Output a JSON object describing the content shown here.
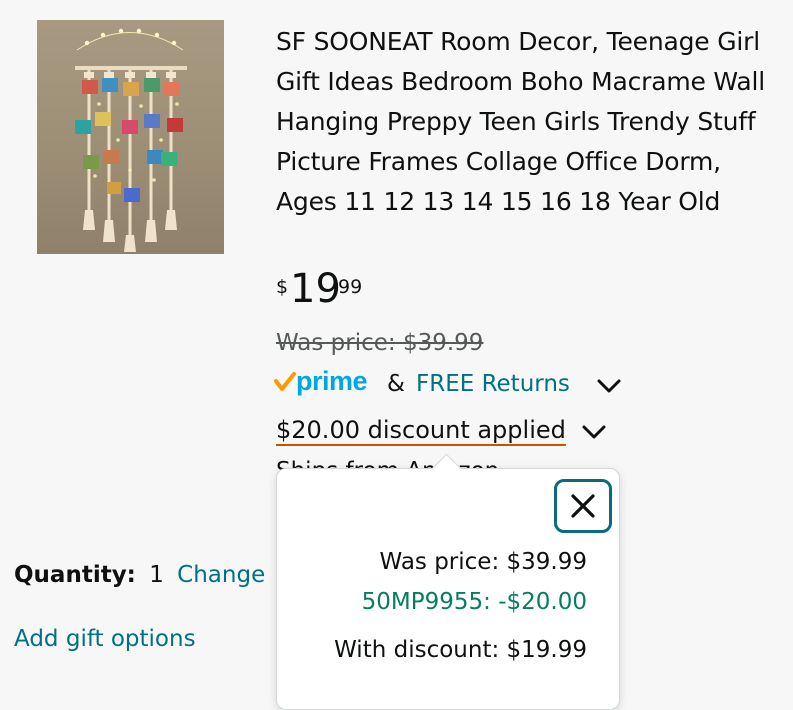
{
  "product": {
    "title": "SF SOONEAT Room Decor, Teenage Girl Gift Ideas Bedroom Boho Macrame Wall Hanging Preppy Teen Girls Trendy Stuff Picture Frames Collage Office Dorm, Ages 11 12 13 14 15 16 18 Year Old",
    "image_icon": "macrame-photo-wall-hanging"
  },
  "price": {
    "symbol": "$",
    "whole": "19",
    "fraction": "99",
    "was_price": "Was price: $39.99"
  },
  "shipping": {
    "prime_label": "prime",
    "ampersand": "&",
    "free_returns": "FREE Returns",
    "covered_text": "Ships from Amazon"
  },
  "discount": {
    "label": "$20.00 discount applied"
  },
  "quantity": {
    "label": "Quantity:",
    "value": "1",
    "change": "Change"
  },
  "gift_options": "Add gift options",
  "popover": {
    "was_price": "Was price: $39.99",
    "coupon": "50MP9955: -$20.00",
    "with_discount": "With discount: $19.99"
  },
  "colors": {
    "link": "#007185",
    "prime": "#00a8e1",
    "prime_check": "#ff9900",
    "coupon": "#067d62",
    "underline": "#c45500",
    "focus_ring": "#0a6b7c"
  }
}
